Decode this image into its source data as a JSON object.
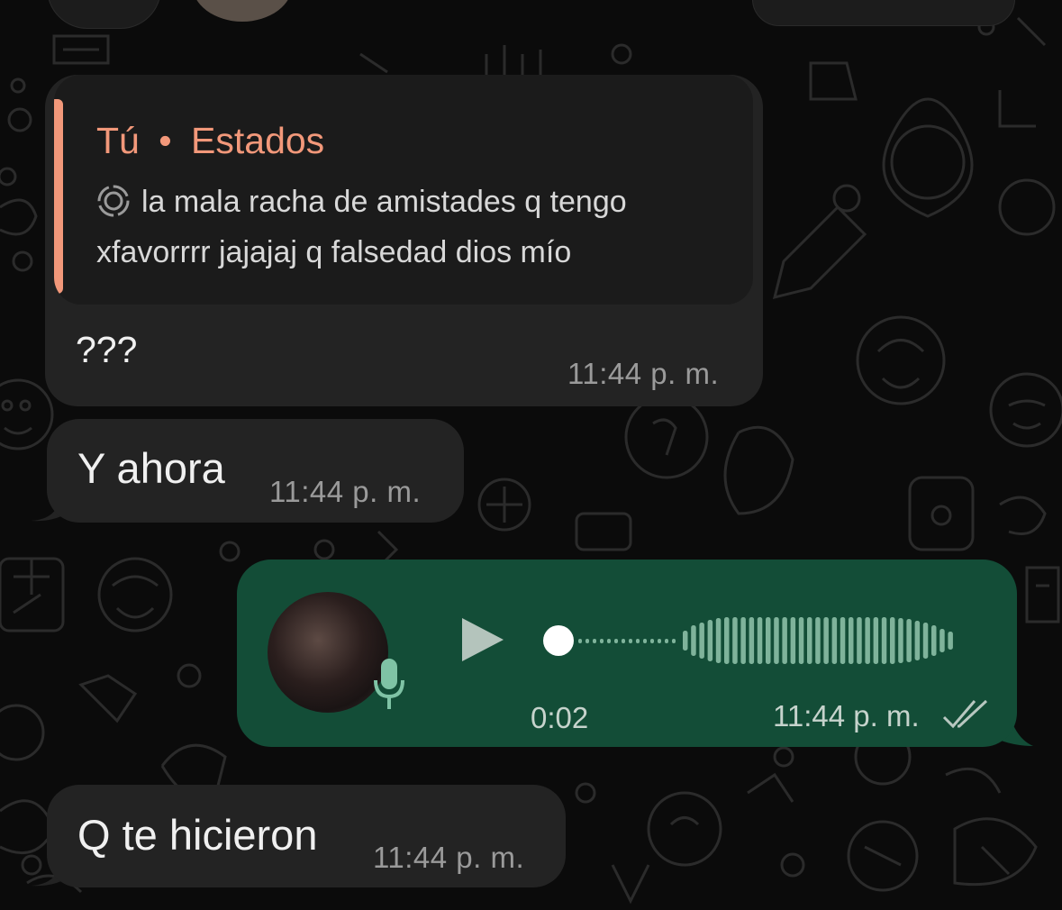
{
  "messages": [
    {
      "direction": "incoming",
      "quote": {
        "sender": "Tú",
        "separator": "•",
        "source": "Estados",
        "icon": "status-ring-icon",
        "text": "la mala racha de amistades q tengo xfavorrrr jajajaj q falsedad dios mío"
      },
      "text": "???",
      "time": "11:44 p. m."
    },
    {
      "direction": "incoming",
      "text": "Y ahora",
      "time": "11:44 p. m."
    },
    {
      "direction": "outgoing",
      "type": "voice-note",
      "duration": "0:02",
      "progress": 0,
      "time": "11:44 p. m.",
      "status": "read-double-check-icon"
    },
    {
      "direction": "incoming",
      "text": "Q te hicieron",
      "time": "11:44 p. m."
    }
  ],
  "colors": {
    "background": "#0b0b0b",
    "incoming_bubble": "#232323",
    "outgoing_bubble": "#134d37",
    "quote_accent": "#f2987a",
    "timestamp": "#9a9a9a"
  }
}
